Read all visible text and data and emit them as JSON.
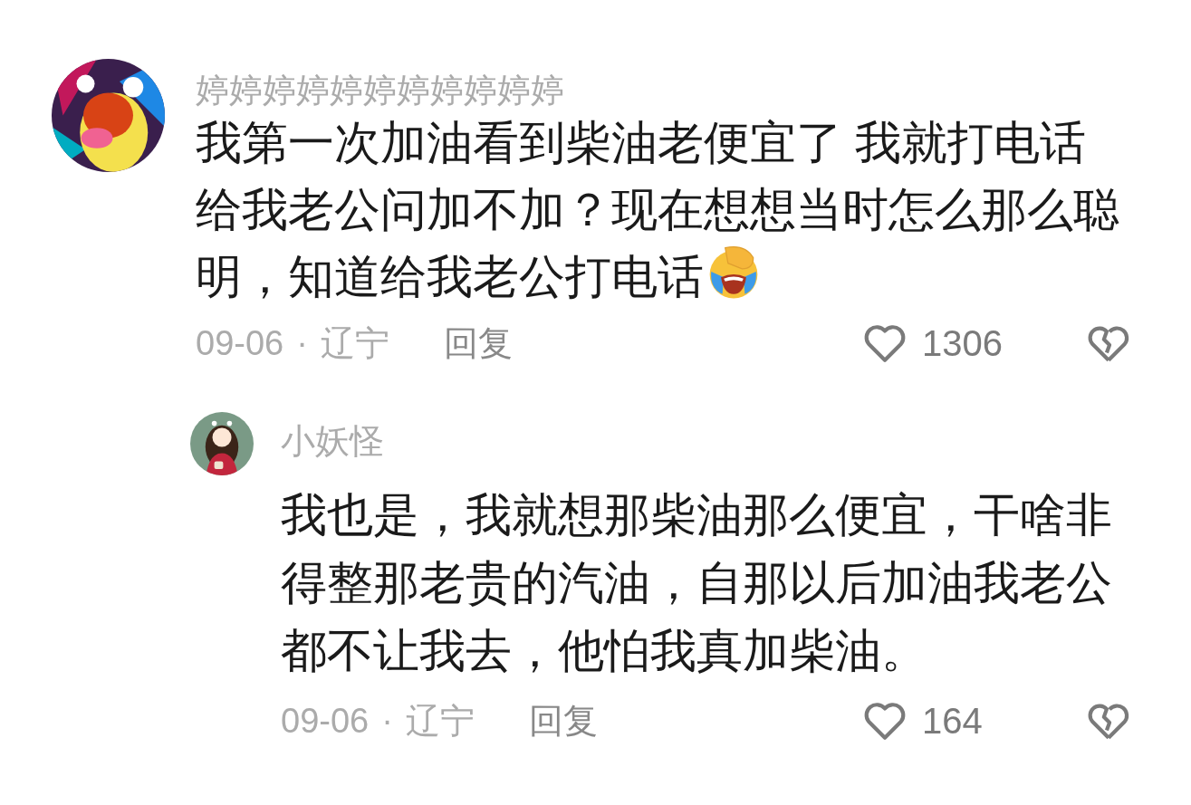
{
  "comments": [
    {
      "name": "婷婷婷婷婷婷婷婷婷婷婷",
      "text": "我第一次加油看到柴油老便宜了 我就打电话给我老公问加不加？现在想想当时怎么那么聪明，知道给我老公打电话",
      "has_emoji": true,
      "date": "09-06",
      "separator": "·",
      "location": "辽宁",
      "reply_label": "回复",
      "likes": "1306",
      "replies": [
        {
          "name": "小妖怪",
          "text": "我也是，我就想那柴油那么便宜，干啥非得整那老贵的汽油，自那以后加油我老公都不让我去，他怕我真加柴油。",
          "date": "09-06",
          "separator": "·",
          "location": "辽宁",
          "reply_label": "回复",
          "likes": "164"
        }
      ]
    }
  ]
}
